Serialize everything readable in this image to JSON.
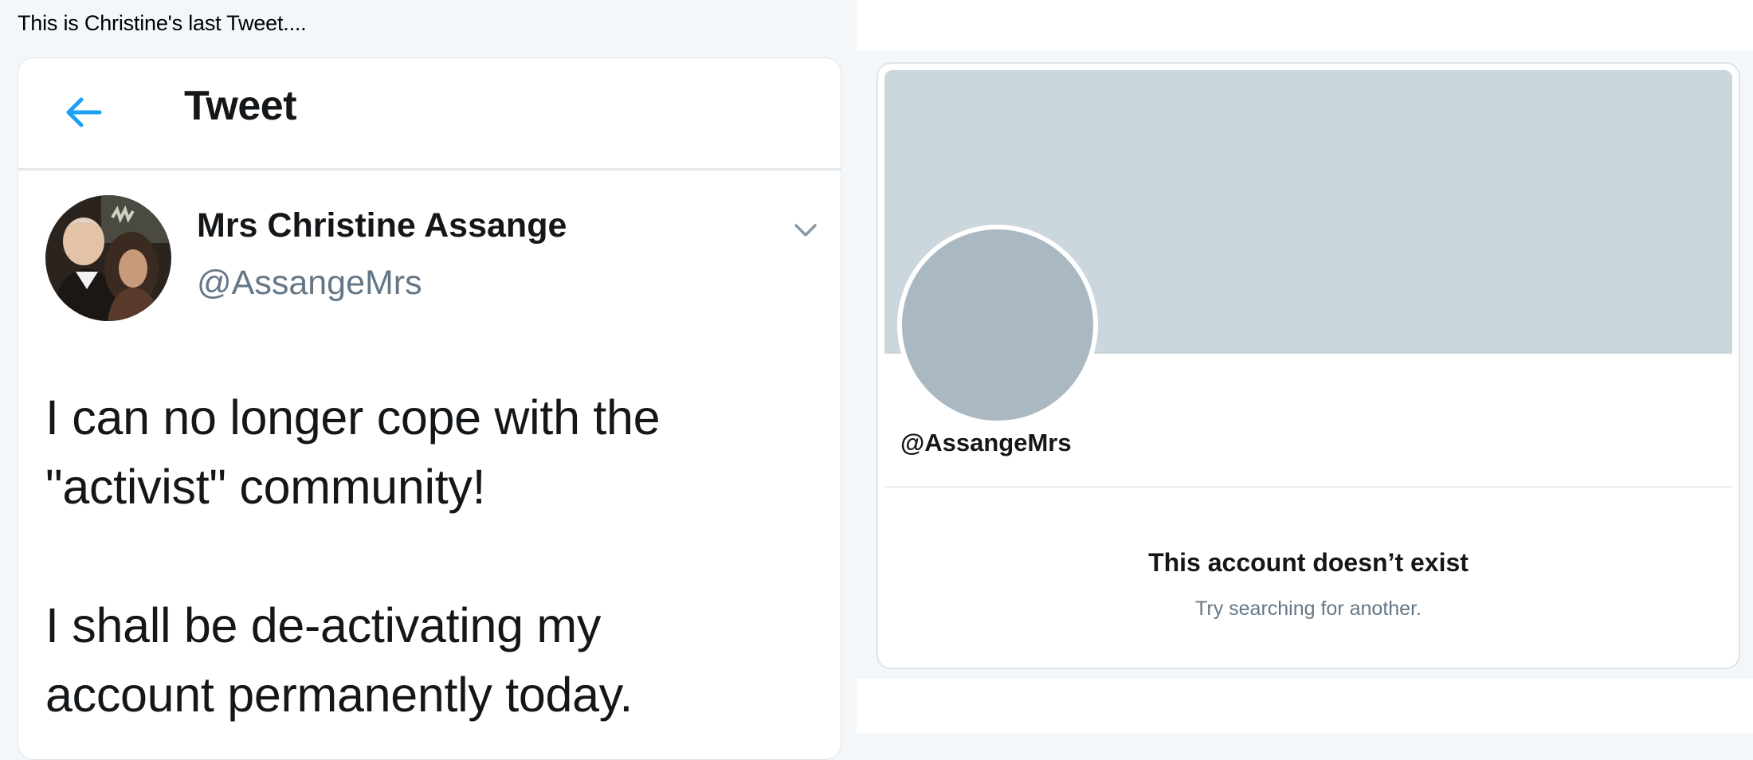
{
  "caption": "This is Christine's last Tweet....",
  "tweet": {
    "header_title": "Tweet",
    "author_name": "Mrs Christine Assange",
    "author_handle": "@AssangeMrs",
    "text_lines": [
      "I can no longer cope with the",
      "\"activist\" community!",
      "I shall be de-activating my",
      "account permanently today."
    ]
  },
  "profile": {
    "handle": "@AssangeMrs",
    "empty_title": "This account doesn’t exist",
    "empty_subtitle": "Try searching for another."
  },
  "colors": {
    "accent": "#1da1f2",
    "banner": "#ccd6dd",
    "avatar_placeholder": "#aab8c2",
    "secondary_text": "#657786"
  }
}
